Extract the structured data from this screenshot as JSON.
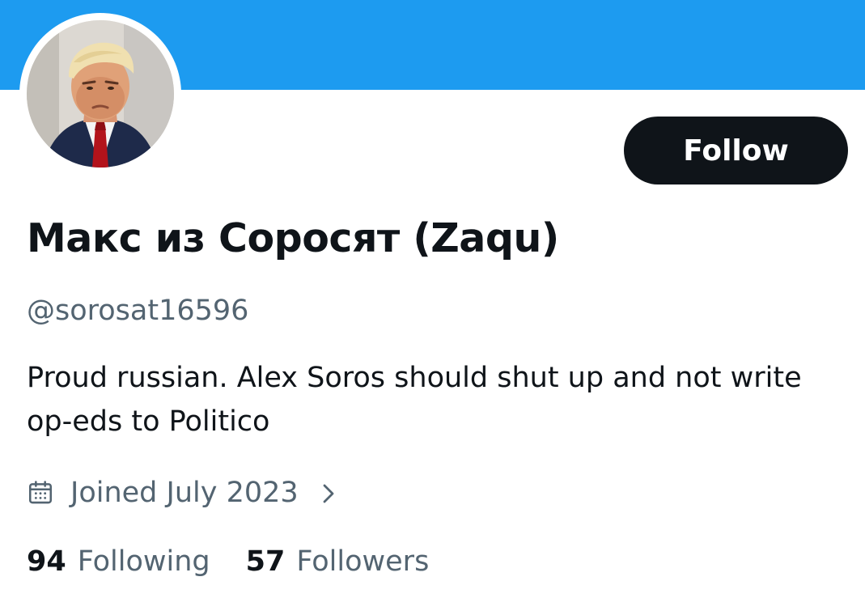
{
  "colors": {
    "banner": "#1d9bf0",
    "primary_text": "#0f1419",
    "secondary_text": "#536471",
    "follow_button_bg": "#0f1419",
    "follow_button_text": "#ffffff"
  },
  "profile": {
    "display_name": "Макс из Соросят (Zaqu)",
    "handle": "@sorosat16596",
    "bio": "Proud russian. Alex Soros should shut up and not write op-eds to Politico",
    "joined": "Joined July 2023",
    "avatar_icon": "profile-photo",
    "follow_label": "Follow"
  },
  "stats": {
    "following_count": "94",
    "following_label": "Following",
    "followers_count": "57",
    "followers_label": "Followers"
  },
  "icons": {
    "joined": "calendar-icon",
    "joined_chevron": "chevron-right-icon"
  }
}
